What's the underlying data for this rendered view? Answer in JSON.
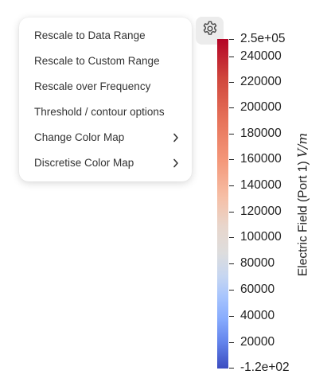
{
  "menu": {
    "items": [
      {
        "label": "Rescale to Data Range",
        "submenu": false
      },
      {
        "label": "Rescale to Custom Range",
        "submenu": false
      },
      {
        "label": "Rescale over Frequency",
        "submenu": false
      },
      {
        "label": "Threshold / contour options",
        "submenu": false
      },
      {
        "label": "Change Color Map",
        "submenu": true
      },
      {
        "label": "Discretise Color Map",
        "submenu": true
      }
    ]
  },
  "settings_button": {
    "icon": "gear-icon"
  },
  "colorbar": {
    "max_label": "2.5e+05",
    "min_label": "-1.2e+02",
    "tick_labels": [
      "240000",
      "220000",
      "200000",
      "180000",
      "160000",
      "140000",
      "120000",
      "100000",
      "80000",
      "60000",
      "40000",
      "20000"
    ],
    "title": "Electric Field (Port 1)",
    "unit": "V/m",
    "colormap": "coolwarm",
    "colors": {
      "top": "#b40426",
      "middle": "#dddddd",
      "bottom": "#3b4cc0"
    }
  }
}
